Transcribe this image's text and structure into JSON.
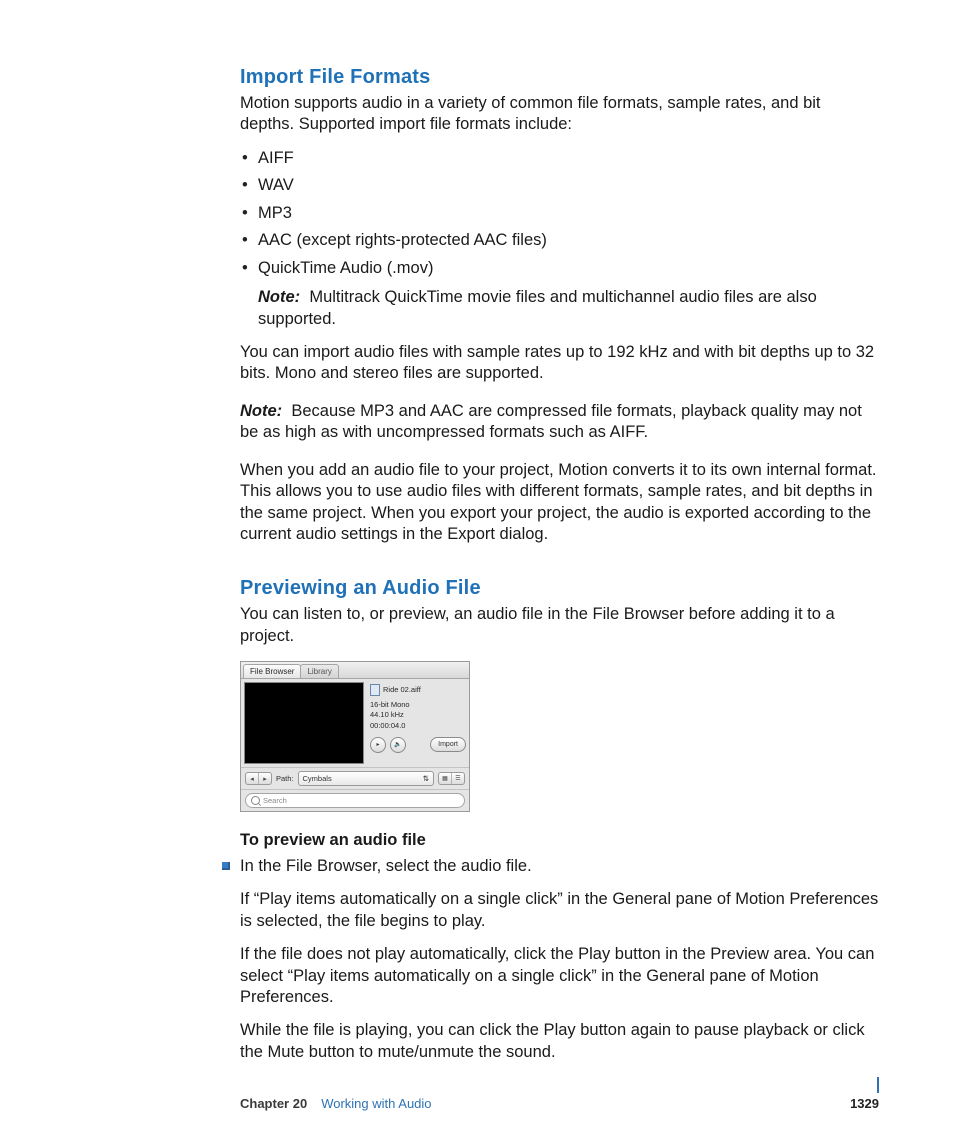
{
  "sections": {
    "s1": {
      "heading": "Import File Formats",
      "p1": "Motion supports audio in a variety of common file formats, sample rates, and bit depths. Supported import file formats include:",
      "bullets": [
        "AIFF",
        "WAV",
        "MP3",
        "AAC (except rights-protected AAC files)",
        "QuickTime Audio (.mov)"
      ],
      "note1_label": "Note:",
      "note1_text": "Multitrack QuickTime movie files and multichannel audio files are also supported.",
      "p2": "You can import audio files with sample rates up to 192 kHz and with bit depths up to 32 bits. Mono and stereo files are supported.",
      "note2_label": "Note:",
      "note2_text": "Because MP3 and AAC are compressed file formats, playback quality may not be as high as with uncompressed formats such as AIFF.",
      "p3": "When you add an audio file to your project, Motion converts it to its own internal format. This allows you to use audio files with different formats, sample rates, and bit depths in the same project. When you export your project, the audio is exported according to the current audio settings in the Export dialog."
    },
    "s2": {
      "heading": "Previewing an Audio File",
      "p1": "You can listen to, or preview, an audio file in the File Browser before adding it to a project.",
      "task_heading": "To preview an audio file",
      "step1": "In the File Browser, select the audio file.",
      "step1_p1": "If “Play items automatically on a single click” in the General pane of Motion Preferences is selected, the file begins to play.",
      "step1_p2": "If the file does not play automatically, click the Play button in the Preview area. You can select “Play items automatically on a single click” in the General pane of Motion Preferences.",
      "step1_p3": "While the file is playing, you can click the Play button again to pause playback or click the Mute button to mute/unmute the sound."
    }
  },
  "ui_mock": {
    "tabs": {
      "active": "File Browser",
      "inactive": "Library"
    },
    "filename": "Ride 02.aiff",
    "meta1": "16-bit Mono",
    "meta2": "44.10 kHz",
    "meta3": "00:00:04.0",
    "import_btn": "Import",
    "path_label": "Path:",
    "path_value": "Cymbals",
    "search_placeholder": "Search"
  },
  "footer": {
    "chapter_label": "Chapter 20",
    "chapter_title": "Working with Audio",
    "page_number": "1329"
  }
}
